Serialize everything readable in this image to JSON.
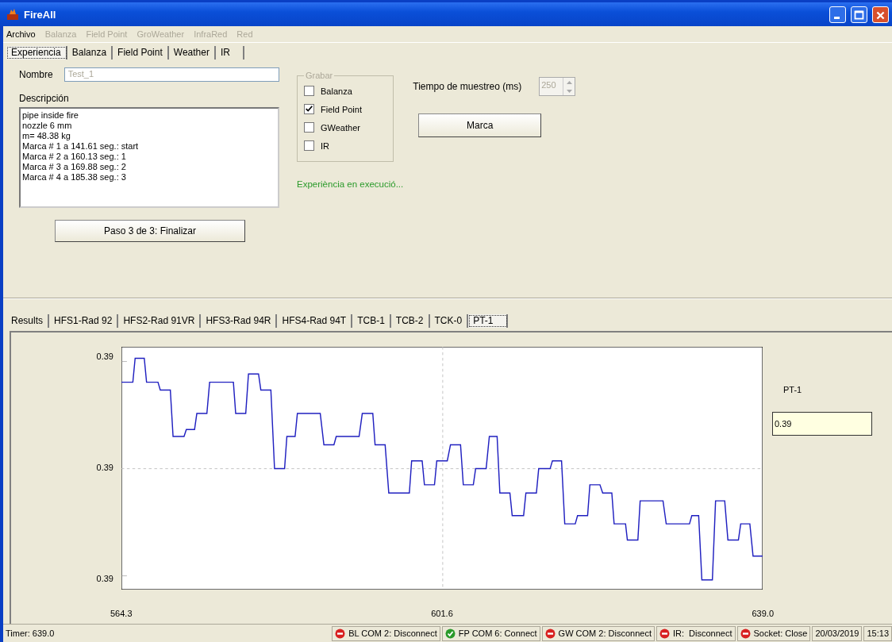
{
  "window": {
    "title": "FireAll"
  },
  "menu": [
    {
      "label": "Archivo",
      "disabled": false
    },
    {
      "label": "Balanza",
      "disabled": true
    },
    {
      "label": "Field Point",
      "disabled": true
    },
    {
      "label": "GroWeather",
      "disabled": true
    },
    {
      "label": "InfraRed",
      "disabled": true
    },
    {
      "label": "Red",
      "disabled": true
    }
  ],
  "tabs": [
    {
      "label": "Experiencia",
      "selected": true
    },
    {
      "label": "Balanza",
      "selected": false
    },
    {
      "label": "Field Point",
      "selected": false
    },
    {
      "label": "Weather",
      "selected": false
    },
    {
      "label": "IR",
      "selected": false
    }
  ],
  "experiment": {
    "name_label": "Nombre",
    "name_value": "Test_1",
    "name_disabled": true,
    "description_label": "Descripción",
    "description_lines": [
      "pipe inside fire",
      "nozzle 6 mm",
      "m= 48.38 kg",
      "Marca # 1 a 141.61 seg.: start",
      "Marca # 2 a 160.13 seg.: 1",
      "Marca # 3 a 169.88 seg.: 2",
      "Marca # 4 a 185.38 seg.: 3"
    ],
    "step_button": "Paso 3 de 3: Finalizar",
    "record_group": {
      "label": "Grabar",
      "disabled": true,
      "options": [
        {
          "label": "Balanza",
          "checked": false
        },
        {
          "label": "Field Point",
          "checked": true
        },
        {
          "label": "GWeather",
          "checked": false
        },
        {
          "label": "IR",
          "checked": false
        }
      ]
    },
    "sampling_label": "Tiempo de muestreo (ms)",
    "sampling_value": "250",
    "sampling_disabled": true,
    "mark_button": "Marca",
    "status_message": "Experiència en execució..."
  },
  "result_tabs": [
    {
      "label": "Results",
      "selected": false
    },
    {
      "label": "HFS1-Rad 92",
      "selected": false
    },
    {
      "label": "HFS2-Rad 91VR",
      "selected": false
    },
    {
      "label": "HFS3-Rad 94R",
      "selected": false
    },
    {
      "label": "HFS4-Rad 94T",
      "selected": false
    },
    {
      "label": "TCB-1",
      "selected": false
    },
    {
      "label": "TCB-2",
      "selected": false
    },
    {
      "label": "TCK-0",
      "selected": false
    },
    {
      "label": "PT-1",
      "selected": true
    }
  ],
  "plot": {
    "y_axis_labels": [
      "0.39",
      "0.39",
      "0.39"
    ],
    "x_axis_labels": [
      "564.3",
      "601.6",
      "639.0"
    ],
    "legend": "PT-1",
    "current_value": "0.39"
  },
  "status_bar": {
    "timer": "Timer: 639.0",
    "connections": [
      {
        "label": "BL COM 2: Disconnect",
        "kind": "disconnected"
      },
      {
        "label": "FP COM 6: Connect",
        "kind": "connected"
      },
      {
        "label": "GW COM 2: Disconnect",
        "kind": "disconnected"
      },
      {
        "label": "IR:  Disconnect",
        "kind": "disconnected"
      },
      {
        "label": "Socket: Close",
        "kind": "disconnected"
      }
    ],
    "date": "20/03/2019",
    "time": "15:13"
  }
}
